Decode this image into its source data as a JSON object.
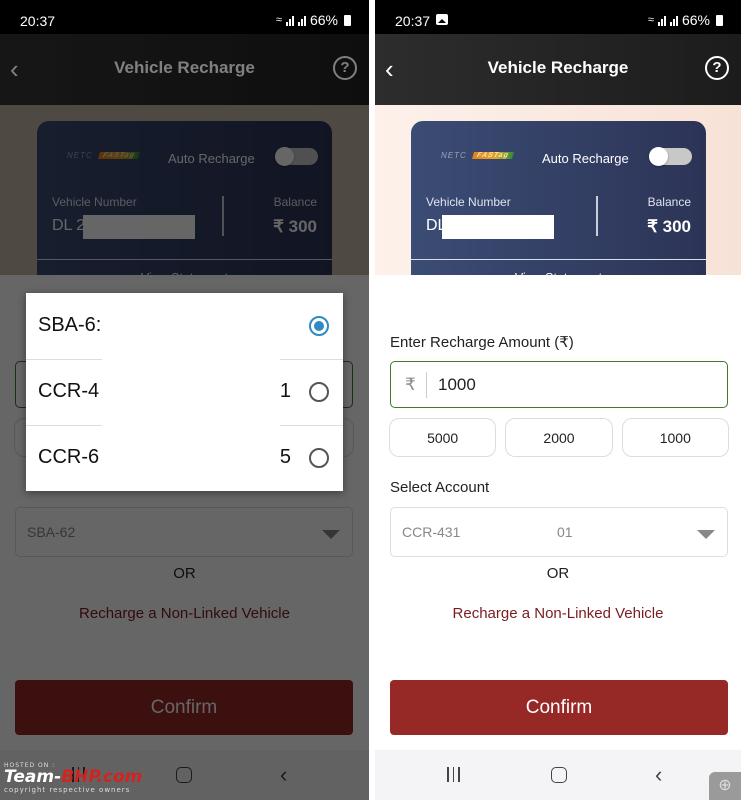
{
  "colors": {
    "primary": "#962826",
    "link": "#7b1c22",
    "input_border_active": "#3d7a2d",
    "radio_selected": "#2f8ac6",
    "card_start": "#3b4c75",
    "card_end": "#2c3456"
  },
  "left_screen": {
    "status_bar": {
      "time": "20:37",
      "battery": "66%",
      "sim1": "VoLTE1",
      "sim2": "VoLTE2",
      "icons": [
        "wifi-icon",
        "signal-icon",
        "signal-icon",
        "battery-icon"
      ]
    },
    "app_bar": {
      "title": "Vehicle Recharge",
      "back_icon": "‹",
      "help_icon": "?"
    },
    "card": {
      "logo_netc": "NETC",
      "logo_fastag": "FASTag",
      "auto_recharge_label": "Auto Recharge",
      "auto_recharge_on": false,
      "vehicle_number_label": "Vehicle Number",
      "vehicle_number_value": "DL 2",
      "balance_label": "Balance",
      "balance_value": "₹ 300",
      "view_statement": "View Statement"
    },
    "form": {
      "select_account_value": "SBA-62",
      "or_text": "OR",
      "non_linked_link": "Recharge a Non-Linked Vehicle",
      "confirm_label": "Confirm"
    },
    "account_dialog": {
      "options": [
        {
          "label": "SBA-6:",
          "tail": "",
          "selected": true
        },
        {
          "label": "CCR-4",
          "tail": "1",
          "selected": false
        },
        {
          "label": "CCR-6",
          "tail": "5",
          "selected": false
        }
      ]
    },
    "watermark": {
      "hosted": "HOSTED ON :",
      "brand_a": "Team-",
      "brand_b": "BHP.com",
      "copyright": "copyright respective owners"
    }
  },
  "right_screen": {
    "status_bar": {
      "time": "20:37",
      "battery": "66%",
      "sim1": "VoLTE1",
      "sim2": "VoLTE2",
      "icons": [
        "gallery-icon",
        "wifi-icon",
        "signal-icon",
        "signal-icon",
        "battery-icon"
      ]
    },
    "app_bar": {
      "title": "Vehicle Recharge",
      "back_icon": "‹",
      "help_icon": "?"
    },
    "card": {
      "logo_netc": "NETC",
      "logo_fastag": "FASTag",
      "auto_recharge_label": "Auto Recharge",
      "auto_recharge_on": false,
      "vehicle_number_label": "Vehicle Number",
      "vehicle_number_value": "DL",
      "balance_label": "Balance",
      "balance_value": "₹ 300",
      "view_statement": "View Statement"
    },
    "form": {
      "amount_label": "Enter Recharge Amount (₹)",
      "currency_symbol": "₹",
      "amount_value": "1000",
      "quick_amounts": [
        "5000",
        "2000",
        "1000"
      ],
      "select_account_label": "Select Account",
      "select_account_value": "CCR-431",
      "select_account_tail": "01",
      "or_text": "OR",
      "non_linked_link": "Recharge a Non-Linked Vehicle",
      "confirm_label": "Confirm"
    },
    "nav_bar": {
      "recents": "recents-icon",
      "home": "home-icon",
      "back": "‹"
    },
    "zoom_badge": "⊕"
  }
}
